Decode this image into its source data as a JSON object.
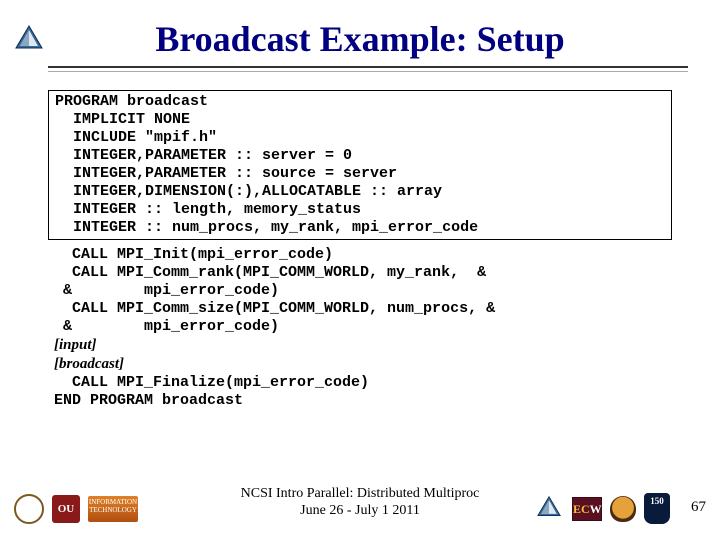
{
  "title": "Broadcast Example: Setup",
  "code1": {
    "l1": "PROGRAM broadcast",
    "l2": "  IMPLICIT NONE",
    "l3": "  INCLUDE \"mpif.h\"",
    "l4": "  INTEGER,PARAMETER :: server = 0",
    "l5": "  INTEGER,PARAMETER :: source = server",
    "l6": "  INTEGER,DIMENSION(:),ALLOCATABLE :: array",
    "l7": "  INTEGER :: length, memory_status",
    "l8": "  INTEGER :: num_procs, my_rank, mpi_error_code"
  },
  "code2": {
    "l1": "  CALL MPI_Init(mpi_error_code)",
    "l2": "  CALL MPI_Comm_rank(MPI_COMM_WORLD, my_rank,  &",
    "l3": " &        mpi_error_code)",
    "l4": "  CALL MPI_Comm_size(MPI_COMM_WORLD, num_procs, &",
    "l5": " &        mpi_error_code)",
    "i1": "  [input]",
    "i2": "  [broadcast]",
    "l6": "  CALL MPI_Finalize(mpi_error_code)",
    "l7": "END PROGRAM broadcast"
  },
  "footer": {
    "line1": "NCSI Intro Parallel: Distributed Multiproc",
    "line2": "June 26 - July 1 2011"
  },
  "logos": {
    "ou": "OU",
    "it": "INFORMATION TECHNOLOGY",
    "ec": "EC",
    "w": "W",
    "shield": "150"
  },
  "page": "67"
}
